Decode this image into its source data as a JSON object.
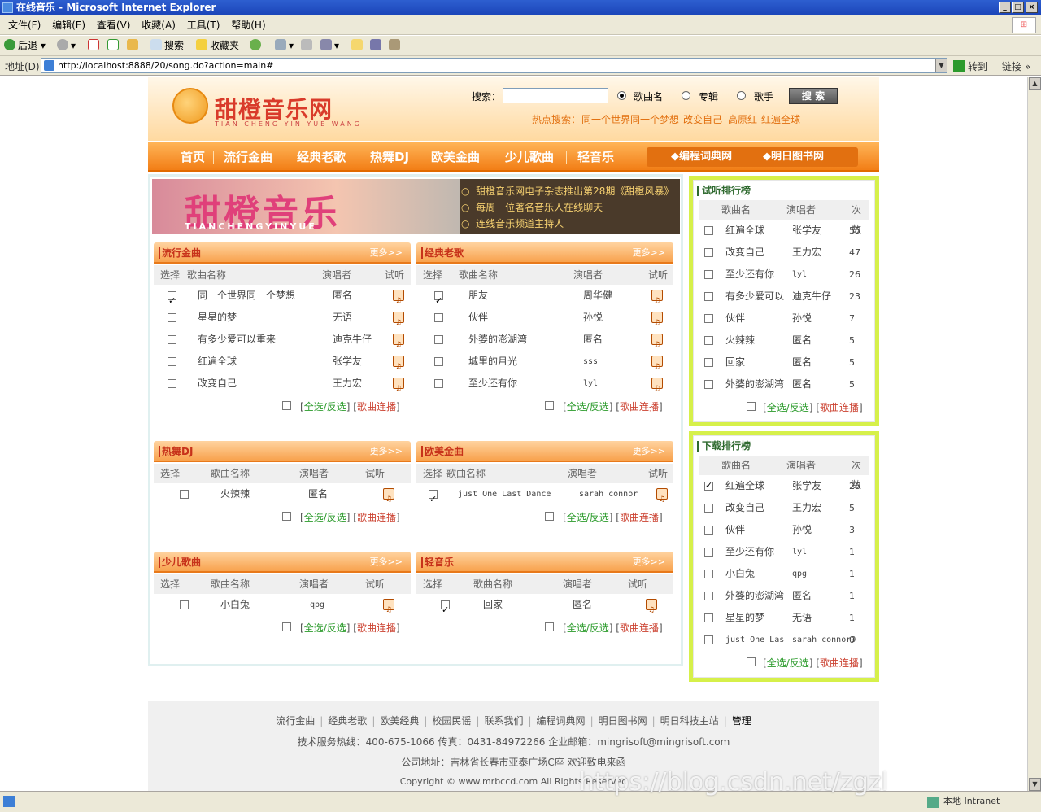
{
  "window": {
    "title": "在线音乐 - Microsoft Internet Explorer"
  },
  "menu": [
    "文件(F)",
    "编辑(E)",
    "查看(V)",
    "收藏(A)",
    "工具(T)",
    "帮助(H)"
  ],
  "toolbar": {
    "back": "后退",
    "search": "搜索",
    "favorites": "收藏夹"
  },
  "address": {
    "label": "地址(D)",
    "url": "http://localhost:8888/20/song.do?action=main#",
    "go": "转到",
    "links": "链接"
  },
  "status": {
    "zone": "本地 Intranet"
  },
  "header": {
    "logo_text": "甜橙音乐网",
    "logo_sub": "TIAN CHENG YIN YUE WANG",
    "search_label": "搜索：",
    "options": [
      "歌曲名",
      "专辑",
      "歌手"
    ],
    "search_button": "搜 索",
    "hot_label": "热点搜索：",
    "hot_items": [
      "同一个世界同一个梦想",
      "改变自己",
      "高原红",
      "红遍全球"
    ]
  },
  "nav": {
    "items": [
      "首页",
      "流行金曲",
      "经典老歌",
      "热舞DJ",
      "欧美金曲",
      "少儿歌曲",
      "轻音乐"
    ],
    "links": [
      "◆编程词典网",
      "◆明日图书网"
    ]
  },
  "banner": {
    "title": "甜橙音乐",
    "sub": "TIANCHENGYINYUE",
    "news": [
      "甜橙音乐网电子杂志推出第28期《甜橙风暴》",
      "每周一位著名音乐人在线聊天",
      "连线音乐频道主持人"
    ]
  },
  "panel_labels": {
    "more": "更多>>",
    "col_select": "选择",
    "col_name": "歌曲名称",
    "col_singer": "演唱者",
    "col_listen": "试听",
    "select_all": "全选/反选",
    "play": "歌曲连播",
    "bl": "[",
    "br": "]"
  },
  "panels": [
    {
      "title": "流行金曲",
      "rows": [
        {
          "name": "同一个世界同一个梦想",
          "singer": "匿名",
          "checked": true
        },
        {
          "name": "星星的梦",
          "singer": "无语",
          "checked": false
        },
        {
          "name": "有多少爱可以重来",
          "singer": "迪克牛仔",
          "checked": false
        },
        {
          "name": "红遍全球",
          "singer": "张学友",
          "checked": false
        },
        {
          "name": "改变自己",
          "singer": "王力宏",
          "checked": false
        }
      ]
    },
    {
      "title": "经典老歌",
      "rows": [
        {
          "name": "朋友",
          "singer": "周华健",
          "checked": true
        },
        {
          "name": "伙伴",
          "singer": "孙悦",
          "checked": false
        },
        {
          "name": "外婆的澎湖湾",
          "singer": "匿名",
          "checked": false
        },
        {
          "name": "城里的月光",
          "singer": "sss",
          "checked": false
        },
        {
          "name": "至少还有你",
          "singer": "lyl",
          "checked": false
        }
      ]
    },
    {
      "title": "热舞DJ",
      "rows": [
        {
          "name": "火辣辣",
          "singer": "匿名",
          "checked": false
        }
      ]
    },
    {
      "title": "欧美金曲",
      "rows": [
        {
          "name": "just One Last Dance",
          "singer": "sarah connor",
          "checked": true
        }
      ]
    },
    {
      "title": "少儿歌曲",
      "rows": [
        {
          "name": "小白兔",
          "singer": "qpg",
          "checked": false
        }
      ]
    },
    {
      "title": "轻音乐",
      "rows": [
        {
          "name": "回家",
          "singer": "匿名",
          "checked": true
        }
      ]
    }
  ],
  "rank_labels": {
    "col_name": "歌曲名",
    "col_singer": "演唱者",
    "col_count": "次数"
  },
  "listen_rank": {
    "title": "试听排行榜",
    "rows": [
      {
        "name": "红遍全球",
        "singer": "张学友",
        "count": "55",
        "checked": false
      },
      {
        "name": "改变自己",
        "singer": "王力宏",
        "count": "47",
        "checked": false
      },
      {
        "name": "至少还有你",
        "singer": "lyl",
        "count": "26",
        "checked": false
      },
      {
        "name": "有多少爱可以",
        "singer": "迪克牛仔",
        "count": "23",
        "checked": false
      },
      {
        "name": "伙伴",
        "singer": "孙悦",
        "count": "7",
        "checked": false
      },
      {
        "name": "火辣辣",
        "singer": "匿名",
        "count": "5",
        "checked": false
      },
      {
        "name": "回家",
        "singer": "匿名",
        "count": "5",
        "checked": false
      },
      {
        "name": "外婆的澎湖湾",
        "singer": "匿名",
        "count": "5",
        "checked": false
      }
    ]
  },
  "download_rank": {
    "title": "下载排行榜",
    "rows": [
      {
        "name": "红遍全球",
        "singer": "张学友",
        "count": "26",
        "checked": true
      },
      {
        "name": "改变自己",
        "singer": "王力宏",
        "count": "5",
        "checked": false
      },
      {
        "name": "伙伴",
        "singer": "孙悦",
        "count": "3",
        "checked": false
      },
      {
        "name": "至少还有你",
        "singer": "lyl",
        "count": "1",
        "checked": false
      },
      {
        "name": "小白兔",
        "singer": "qpg",
        "count": "1",
        "checked": false
      },
      {
        "name": "外婆的澎湖湾",
        "singer": "匿名",
        "count": "1",
        "checked": false
      },
      {
        "name": "星星的梦",
        "singer": "无语",
        "count": "1",
        "checked": false
      },
      {
        "name": "just One Las",
        "singer": "sarah connor0",
        "count": "0",
        "checked": false
      }
    ]
  },
  "footer": {
    "links": [
      "流行金曲",
      "经典老歌",
      "欧美经典",
      "校园民谣",
      "联系我们",
      "编程词典网",
      "明日图书网",
      "明日科技主站",
      "管理"
    ],
    "hotline": "技术服务热线：400-675-1066 传真：0431-84972266 企业邮箱：mingrisoft@mingrisoft.com",
    "address": "公司地址：吉林省长春市亚泰广场C座 欢迎致电来函",
    "copyright": "Copyright © www.mrbccd.com All Rights Reserved"
  },
  "watermark": "https://blog.csdn.net/zgzl"
}
